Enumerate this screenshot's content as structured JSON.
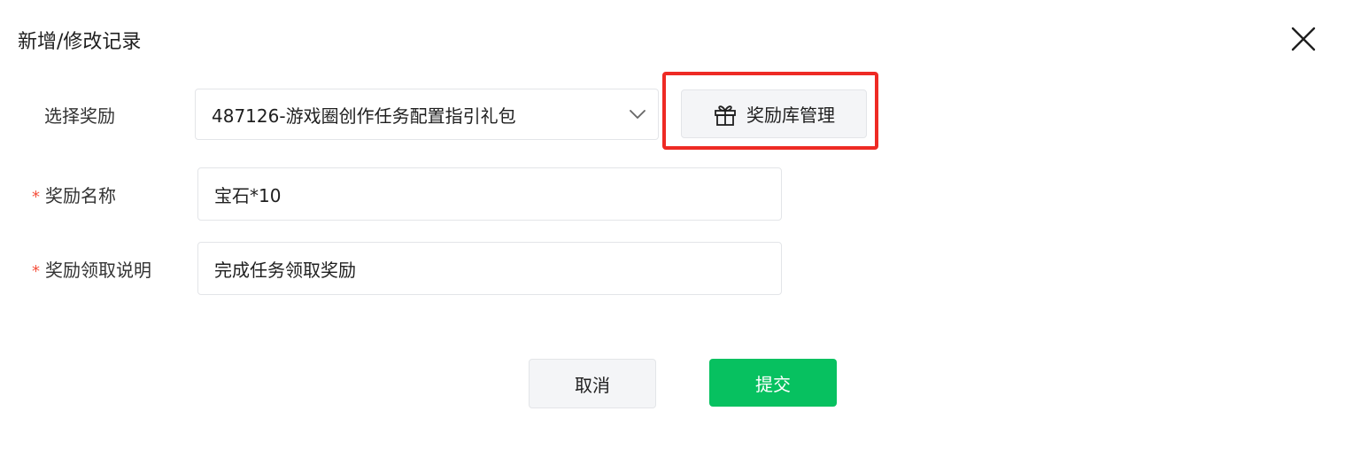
{
  "dialog": {
    "title": "新增/修改记录"
  },
  "form": {
    "select_reward": {
      "label": "选择奖励",
      "value": "487126-游戏圈创作任务配置指引礼包"
    },
    "reward_library_button": {
      "label": "奖励库管理",
      "icon": "gift-icon"
    },
    "reward_name": {
      "required_mark": "*",
      "label": "奖励名称",
      "value": "宝石*10"
    },
    "reward_claim_desc": {
      "required_mark": "*",
      "label": "奖励领取说明",
      "value": "完成任务领取奖励"
    }
  },
  "footer": {
    "cancel_label": "取消",
    "submit_label": "提交"
  },
  "colors": {
    "primary": "#07c160",
    "highlight": "#ee2a24",
    "required": "#f5503c"
  }
}
